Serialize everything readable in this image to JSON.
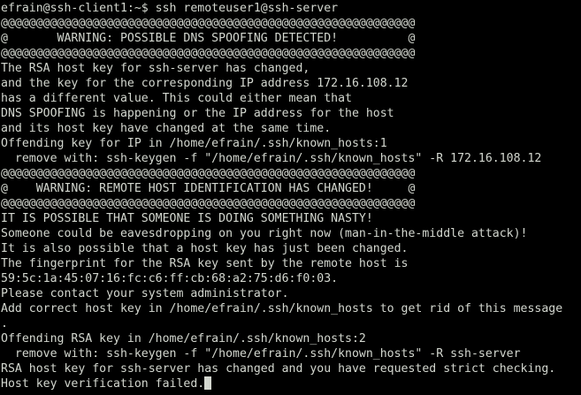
{
  "terminal": {
    "colors": {
      "background": "#000000",
      "foreground": "#d3d7cf"
    },
    "lines": [
      "efrain@ssh-client1:~$ ssh remoteuser1@ssh-server",
      "@@@@@@@@@@@@@@@@@@@@@@@@@@@@@@@@@@@@@@@@@@@@@@@@@@@@@@@@@@@",
      "@       WARNING: POSSIBLE DNS SPOOFING DETECTED!          @",
      "@@@@@@@@@@@@@@@@@@@@@@@@@@@@@@@@@@@@@@@@@@@@@@@@@@@@@@@@@@@",
      "The RSA host key for ssh-server has changed,",
      "and the key for the corresponding IP address 172.16.108.12",
      "has a different value. This could either mean that",
      "DNS SPOOFING is happening or the IP address for the host",
      "and its host key have changed at the same time.",
      "Offending key for IP in /home/efrain/.ssh/known_hosts:1",
      "  remove with: ssh-keygen -f \"/home/efrain/.ssh/known_hosts\" -R 172.16.108.12",
      "@@@@@@@@@@@@@@@@@@@@@@@@@@@@@@@@@@@@@@@@@@@@@@@@@@@@@@@@@@@",
      "@    WARNING: REMOTE HOST IDENTIFICATION HAS CHANGED!     @",
      "@@@@@@@@@@@@@@@@@@@@@@@@@@@@@@@@@@@@@@@@@@@@@@@@@@@@@@@@@@@",
      "IT IS POSSIBLE THAT SOMEONE IS DOING SOMETHING NASTY!",
      "Someone could be eavesdropping on you right now (man-in-the-middle attack)!",
      "It is also possible that a host key has just been changed.",
      "The fingerprint for the RSA key sent by the remote host is",
      "59:5c:1a:45:07:16:fc:c6:ff:cb:68:a2:75:d6:f0:03.",
      "Please contact your system administrator.",
      "Add correct host key in /home/efrain/.ssh/known_hosts to get rid of this message",
      ".",
      "Offending RSA key in /home/efrain/.ssh/known_hosts:2",
      "  remove with: ssh-keygen -f \"/home/efrain/.ssh/known_hosts\" -R ssh-server",
      "RSA host key for ssh-server has changed and you have requested strict checking.",
      "Host key verification failed."
    ]
  }
}
